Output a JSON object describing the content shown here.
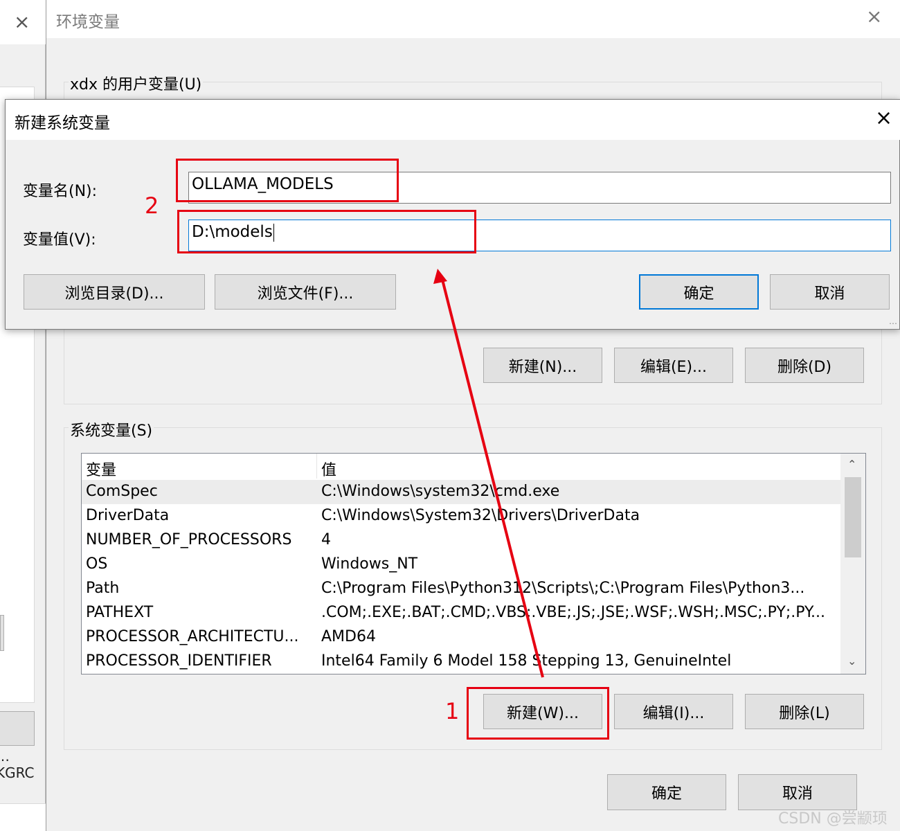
{
  "background_window": {
    "close_glyph": "×",
    "cut_text": "…KGRC"
  },
  "env_window": {
    "title": "环境变量",
    "close_glyph": "×",
    "user_vars": {
      "group_label": "xdx 的用户变量(U)",
      "buttons": {
        "new": "新建(N)...",
        "edit": "编辑(E)...",
        "delete": "删除(D)"
      }
    },
    "system_vars": {
      "group_label": "系统变量(S)",
      "columns": [
        "变量",
        "值"
      ],
      "rows": [
        {
          "name": "ComSpec",
          "value": "C:\\Windows\\system32\\cmd.exe"
        },
        {
          "name": "DriverData",
          "value": "C:\\Windows\\System32\\Drivers\\DriverData"
        },
        {
          "name": "NUMBER_OF_PROCESSORS",
          "value": "4"
        },
        {
          "name": "OS",
          "value": "Windows_NT"
        },
        {
          "name": "Path",
          "value": "C:\\Program Files\\Python312\\Scripts\\;C:\\Program Files\\Python3..."
        },
        {
          "name": "PATHEXT",
          "value": ".COM;.EXE;.BAT;.CMD;.VBS;.VBE;.JS;.JSE;.WSF;.WSH;.MSC;.PY;.PY..."
        },
        {
          "name": "PROCESSOR_ARCHITECTU...",
          "value": "AMD64"
        },
        {
          "name": "PROCESSOR_IDENTIFIER",
          "value": "Intel64 Family 6 Model 158 Stepping 13, GenuineIntel"
        }
      ],
      "buttons": {
        "new": "新建(W)...",
        "edit": "编辑(I)...",
        "delete": "删除(L)"
      }
    },
    "ok": "确定",
    "cancel": "取消"
  },
  "new_var_dialog": {
    "title": "新建系统变量",
    "close_glyph": "×",
    "name_label": "变量名(N):",
    "name_value": "OLLAMA_MODELS",
    "value_label": "变量值(V):",
    "value_value": "D:\\models",
    "browse_dir": "浏览目录(D)...",
    "browse_file": "浏览文件(F)...",
    "ok": "确定",
    "cancel": "取消"
  },
  "annotations": {
    "step1": "1",
    "step2": "2",
    "color": "#e60012"
  },
  "watermark": "CSDN @尝颛顼"
}
